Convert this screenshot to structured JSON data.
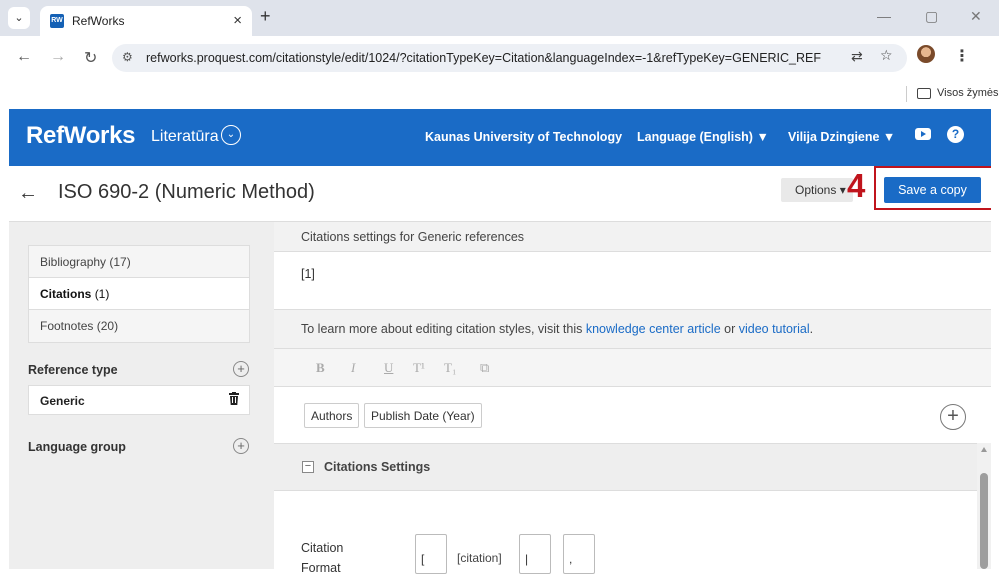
{
  "browser": {
    "tab_menu_icon": "chevron-down-icon",
    "tab_favicon_text": "RW",
    "tab_title": "RefWorks",
    "tab_close": "×",
    "new_tab": "+",
    "url": "refworks.proquest.com/citationstyle/edit/1024/?citationTypeKey=Citation&languageIndex=-1&refTypeKey=GENERIC_REF",
    "bookmarks_label": "Visos žymės"
  },
  "header": {
    "logo": "RefWorks",
    "library_label": "Literatūra",
    "institution": "Kaunas University of Technology",
    "language": "Language (English) ▼",
    "user": "Vilija Dzingiene ▼"
  },
  "title_bar": {
    "title": "ISO 690-2 (Numeric Method)",
    "options_label": "Options",
    "annotation": "4",
    "save_label": "Save a copy"
  },
  "sidebar": {
    "sections": [
      {
        "label": "Bibliography",
        "count": "(17)"
      },
      {
        "label": "Citations",
        "count": "(1)"
      },
      {
        "label": "Footnotes",
        "count": "(20)"
      }
    ],
    "reference_type_heading": "Reference type",
    "reference_type_value": "Generic",
    "language_group_heading": "Language group"
  },
  "main": {
    "settings_heading": "Citations settings for Generic references",
    "preview": "[1]",
    "info_prefix": "To learn more about editing citation styles, visit this ",
    "info_link1": "knowledge center article",
    "info_or": " or ",
    "info_link2": "video tutorial",
    "info_suffix": ".",
    "toolbar": [
      "B",
      "I",
      "U",
      "T¹",
      "T₁",
      "⧉"
    ],
    "fields": [
      "Authors",
      "Publish Date (Year)"
    ],
    "citations_settings_title": "Citations Settings",
    "citation_format_label": "Citation Format",
    "format_prefix": "[",
    "format_token": "[citation]",
    "format_suffix": "|",
    "format_separator": ","
  },
  "colors": {
    "brand_blue": "#1a6bc6",
    "annotation_red": "#c0141c"
  }
}
